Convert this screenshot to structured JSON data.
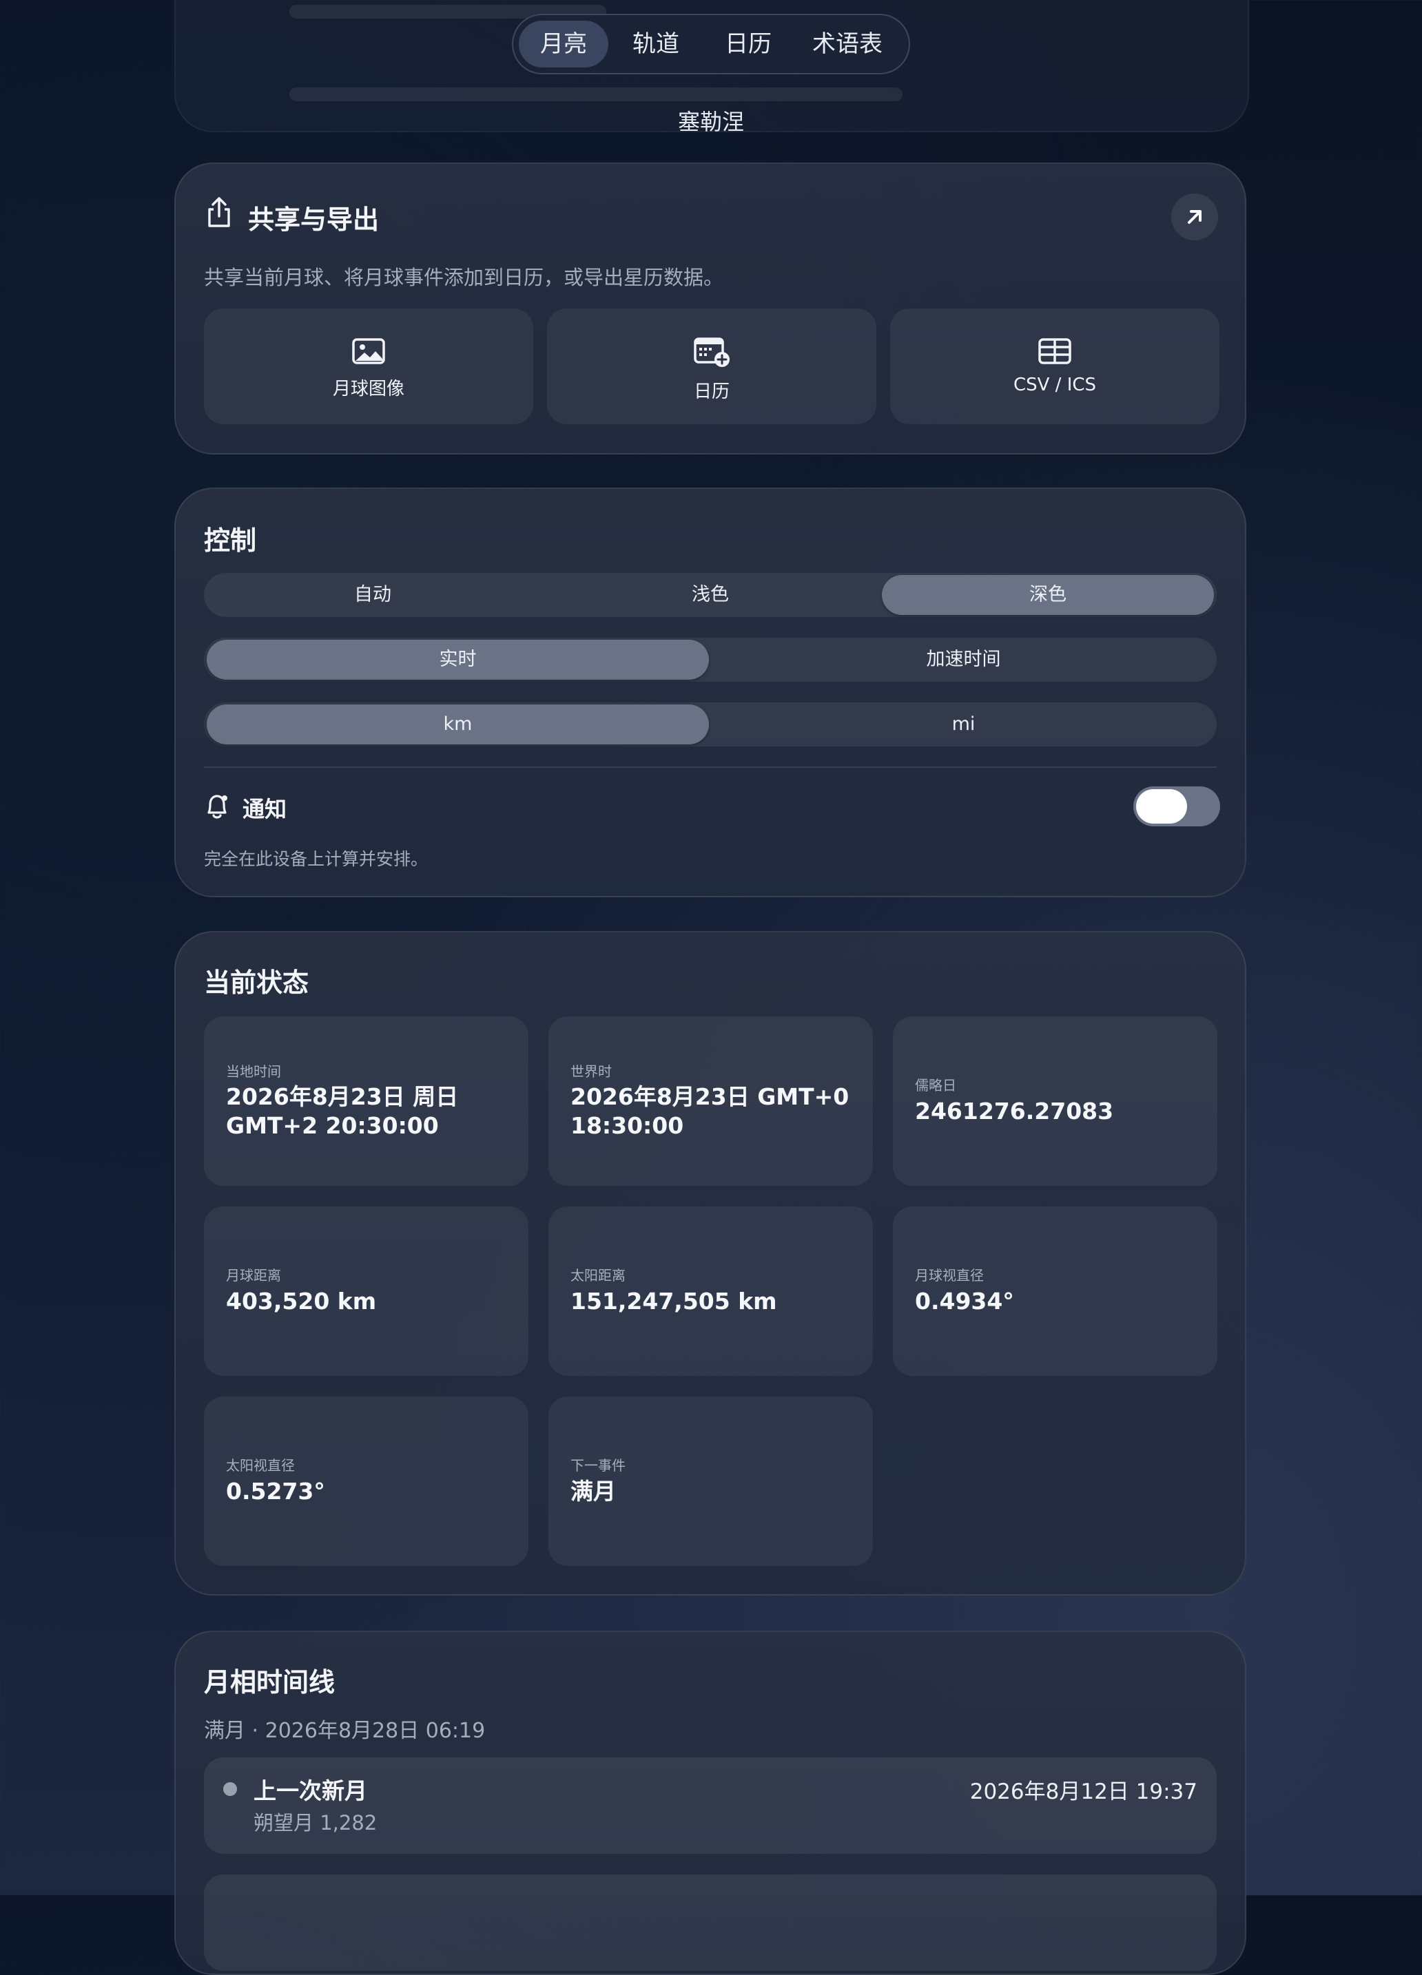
{
  "nav": {
    "tabs": [
      {
        "label": "月亮",
        "active": true
      },
      {
        "label": "轨道",
        "active": false
      },
      {
        "label": "日历",
        "active": false
      },
      {
        "label": "术语表",
        "active": false
      }
    ]
  },
  "location": "塞勒涅",
  "share": {
    "title": "共享与导出",
    "description": "共享当前月球、将月球事件添加到日历，或导出星历数据。",
    "actions": [
      {
        "label": "月球图像",
        "icon": "image-icon"
      },
      {
        "label": "日历",
        "icon": "calendar-add-icon"
      },
      {
        "label": "CSV / ICS",
        "icon": "table-icon"
      }
    ]
  },
  "controls": {
    "title": "控制",
    "theme": {
      "options": [
        "自动",
        "浅色",
        "深色"
      ],
      "selected": "深色"
    },
    "time_mode": {
      "options": [
        "实时",
        "加速时间"
      ],
      "selected": "实时"
    },
    "units": {
      "options": [
        "km",
        "mi"
      ],
      "selected": "km"
    },
    "notifications": {
      "label": "通知",
      "description": "完全在此设备上计算并安排。",
      "enabled": false
    }
  },
  "status": {
    "title": "当前状态",
    "items": [
      {
        "label": "当地时间",
        "value": "2026年8月23日 周日 GMT+2 20:30:00"
      },
      {
        "label": "世界时",
        "value": "2026年8月23日 GMT+0 18:30:00"
      },
      {
        "label": "儒略日",
        "value": "2461276.27083"
      },
      {
        "label": "月球距离",
        "value": "403,520 km"
      },
      {
        "label": "太阳距离",
        "value": "151,247,505 km"
      },
      {
        "label": "月球视直径",
        "value": "0.4934°"
      },
      {
        "label": "太阳视直径",
        "value": "0.5273°"
      },
      {
        "label": "下一事件",
        "value": "满月"
      }
    ]
  },
  "timeline": {
    "title": "月相时间线",
    "subtitle": "满月 · 2026年8月28日 06:19",
    "rows": [
      {
        "title": "上一次新月",
        "detail": "朔望月 1,282",
        "date": "2026年8月12日 19:37"
      }
    ]
  },
  "colors": {
    "accent_selected": "#6a7285",
    "card_bg": "#262f42",
    "background": "#0e1a2e"
  }
}
